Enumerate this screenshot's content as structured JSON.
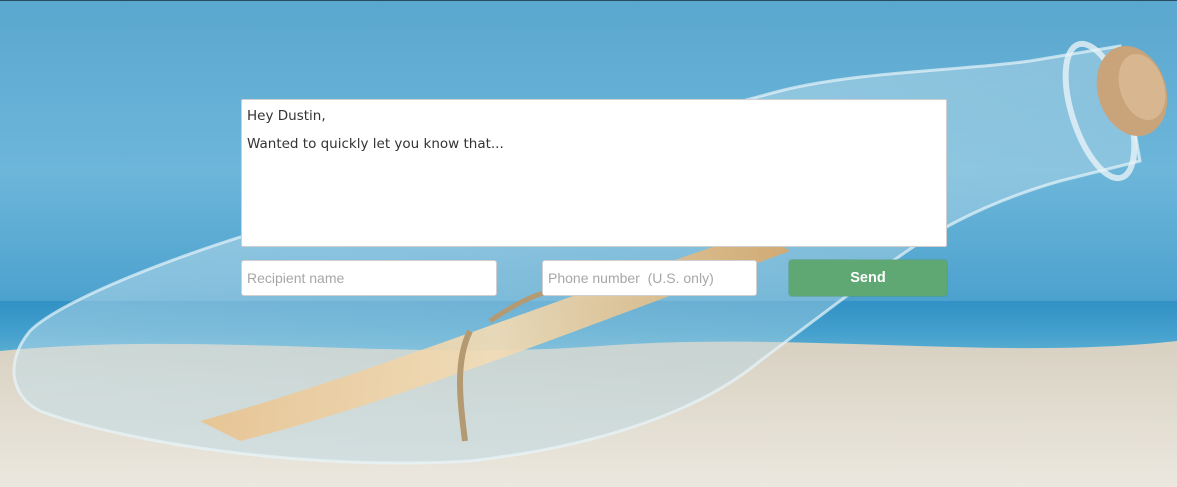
{
  "message": {
    "lines": [
      "Hey Dustin,",
      "Wanted to quickly let you know that..."
    ]
  },
  "form": {
    "recipient_placeholder": "Recipient name",
    "phone_placeholder": "Phone number  (U.S. only)",
    "send_label": "Send"
  },
  "colors": {
    "send_button": "#5fa873",
    "sky": "#5aa7cf",
    "sand": "#e6e1d6"
  },
  "background": {
    "image": "message-in-a-bottle-on-beach"
  }
}
